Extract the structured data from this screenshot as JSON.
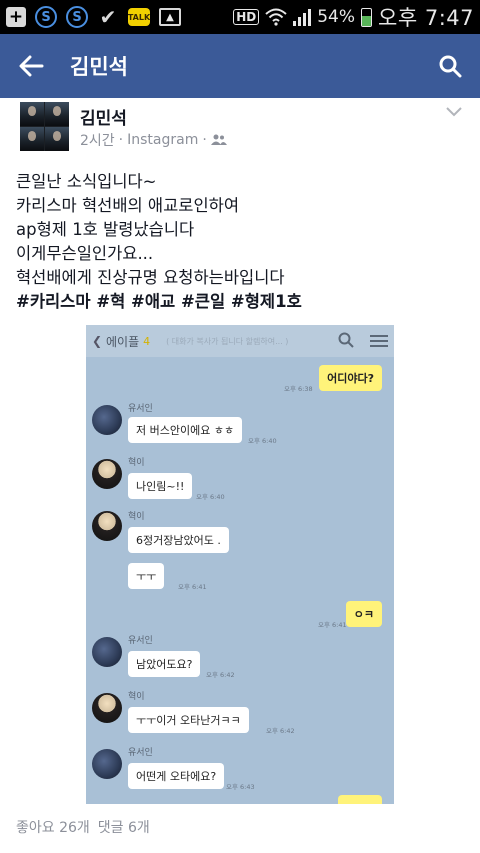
{
  "status_bar": {
    "battery": "54%",
    "time": "오후 7:47",
    "battery_level": 0.54,
    "icons": [
      "plus-icon",
      "s-circle-icon",
      "s-circle-icon",
      "check-icon",
      "talk-icon",
      "image-icon",
      "hd-icon",
      "wifi-icon",
      "signal-icon",
      "battery-icon"
    ]
  },
  "header": {
    "title": "김민석",
    "back_icon": "arrow-left-icon",
    "search_icon": "search-icon",
    "bg_color": "#3b5a98"
  },
  "post": {
    "author": "김민석",
    "time": "2시간",
    "separator": "·",
    "source": "Instagram",
    "separator2": "·",
    "audience_icon": "friends-icon",
    "lines": [
      "큰일난 소식입니다~",
      "카리스마 혁선배의 애교로인하여",
      "ap형제 1호 발령났습니다",
      "이게무슨일인가요...",
      "혁선배에게 진상규명 요청하는바입니다"
    ],
    "hashtags": "#카리스마 #혁 #애교 #큰일 #형제1호",
    "likes": "좋아요 26개",
    "comments": "댓글 6개"
  },
  "chat": {
    "room_name": "에이플",
    "member_count": "4",
    "faded_header": "( 대화가 복사가 됩니다 할렙하여... )",
    "messages": [
      {
        "from": "me",
        "text": "어디야다?",
        "time": "오후 6:38"
      },
      {
        "from": "other",
        "sender": "유서인",
        "text": "저 버스안이에요 ㅎㅎ",
        "time": "오후 6:40"
      },
      {
        "from": "other",
        "sender": "혁이",
        "text": "나인림~!!",
        "time": "오후 6:40"
      },
      {
        "from": "other",
        "sender": "혁이",
        "text": "6정거장남았어도 .",
        "time": ""
      },
      {
        "from": "other_cont",
        "text": "ㅜㅜ",
        "time": "오후 6:41"
      },
      {
        "from": "me",
        "text": "ㅇㅋ",
        "time": "오후 6:41"
      },
      {
        "from": "other",
        "sender": "유서인",
        "text": "남았어도요?",
        "time": "오후 6:42"
      },
      {
        "from": "other",
        "sender": "혁이",
        "text": "ㅜㅜ이거 오타난거ㅋㅋ",
        "time": "오후 6:42"
      },
      {
        "from": "other",
        "sender": "유서인",
        "text": "어떤게 오타에요?",
        "time": "오후 6:43"
      }
    ]
  }
}
